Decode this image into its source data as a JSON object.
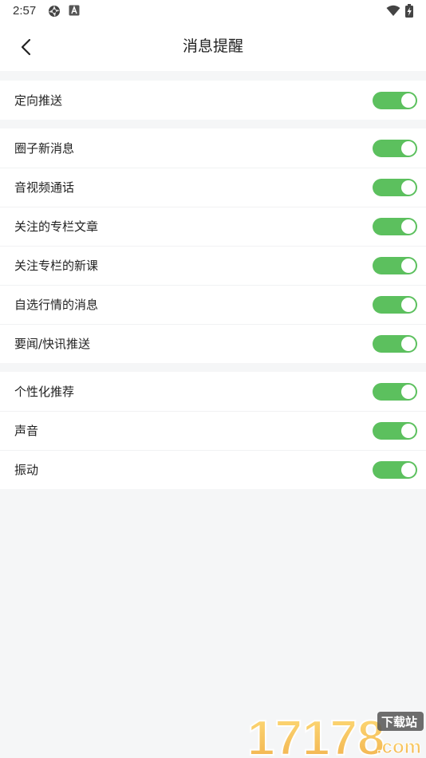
{
  "status_bar": {
    "time": "2:57"
  },
  "header": {
    "title": "消息提醒",
    "back_icon": "chevron-left-icon"
  },
  "sections": [
    {
      "items": [
        {
          "label": "定向推送",
          "enabled": true
        }
      ]
    },
    {
      "items": [
        {
          "label": "圈子新消息",
          "enabled": true
        },
        {
          "label": "音视频通话",
          "enabled": true
        },
        {
          "label": "关注的专栏文章",
          "enabled": true
        },
        {
          "label": "关注专栏的新课",
          "enabled": true
        },
        {
          "label": "自选行情的消息",
          "enabled": true
        },
        {
          "label": "要闻/快讯推送",
          "enabled": true
        }
      ]
    },
    {
      "items": [
        {
          "label": "个性化推荐",
          "enabled": true
        },
        {
          "label": "声音",
          "enabled": true
        },
        {
          "label": "振动",
          "enabled": true
        }
      ]
    }
  ],
  "colors": {
    "toggle_on": "#5cc05e",
    "background": "#f5f6f7"
  },
  "watermark": {
    "number": "17178",
    "badge": "下载站",
    "domain": ".com"
  }
}
